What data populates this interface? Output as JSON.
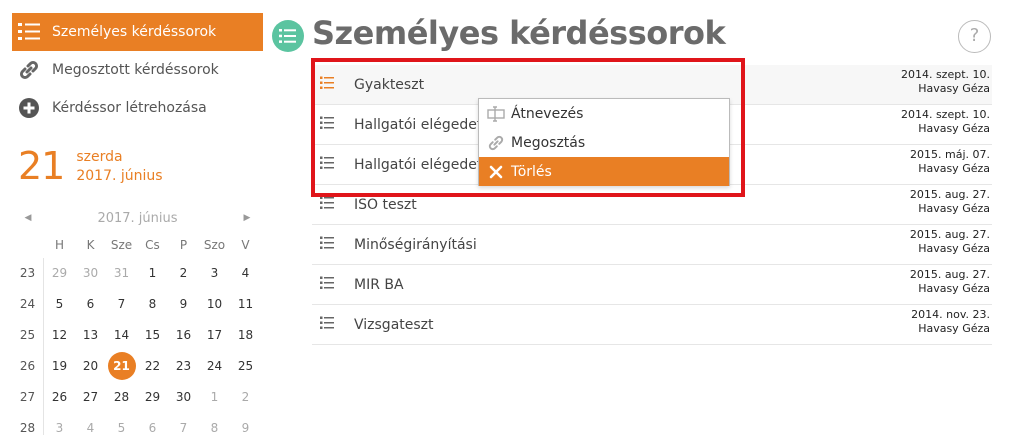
{
  "sidebar": {
    "nav": [
      {
        "label": "Személyes kérdéssorok",
        "icon": "list-icon",
        "active": true
      },
      {
        "label": "Megosztott kérdéssorok",
        "icon": "link-icon",
        "active": false
      },
      {
        "label": "Kérdéssor létrehozása",
        "icon": "plus-circle-icon",
        "active": false
      }
    ],
    "date": {
      "day": "21",
      "weekday": "szerda",
      "month_year": "2017. június"
    },
    "calendar": {
      "month_label": "2017. június",
      "weekdays": [
        "H",
        "K",
        "Sze",
        "Cs",
        "P",
        "Szo",
        "V"
      ],
      "weeks": [
        {
          "num": "23",
          "days": [
            "29",
            "30",
            "31",
            "1",
            "2",
            "3",
            "4"
          ]
        },
        {
          "num": "24",
          "days": [
            "5",
            "6",
            "7",
            "8",
            "9",
            "10",
            "11"
          ]
        },
        {
          "num": "25",
          "days": [
            "12",
            "13",
            "14",
            "15",
            "16",
            "17",
            "18"
          ]
        },
        {
          "num": "26",
          "days": [
            "19",
            "20",
            "21",
            "22",
            "23",
            "24",
            "25"
          ]
        },
        {
          "num": "27",
          "days": [
            "26",
            "27",
            "28",
            "29",
            "30",
            "1",
            "2"
          ]
        },
        {
          "num": "28",
          "days": [
            "3",
            "4",
            "5",
            "6",
            "7",
            "8",
            "9"
          ]
        }
      ],
      "today": "21"
    }
  },
  "main": {
    "title": "Személyes kérdéssorok",
    "help": "?",
    "rows": [
      {
        "name": "Gyakteszt",
        "date": "2014. szept. 10.",
        "author": "Havasy Géza"
      },
      {
        "name": "Hallgatói elégedettség",
        "date": "2014. szept. 10.",
        "author": "Havasy Géza"
      },
      {
        "name": "Hallgatói elégedettség",
        "date": "2015. máj. 07.",
        "author": "Havasy Géza"
      },
      {
        "name": "ISO teszt",
        "date": "2015. aug. 27.",
        "author": "Havasy Géza"
      },
      {
        "name": "Minőségirányítási",
        "date": "2015. aug. 27.",
        "author": "Havasy Géza"
      },
      {
        "name": "MIR BA",
        "date": "2015. aug. 27.",
        "author": "Havasy Géza"
      },
      {
        "name": "Vizsgateszt",
        "date": "2014. nov. 23.",
        "author": "Havasy Géza"
      }
    ],
    "context_menu": [
      {
        "label": "Átnevezés",
        "icon": "rename-icon",
        "active": false
      },
      {
        "label": "Megosztás",
        "icon": "link-icon",
        "active": false
      },
      {
        "label": "Törlés",
        "icon": "close-icon",
        "active": true
      }
    ]
  },
  "colors": {
    "accent": "#e97f24",
    "title_icon_bg": "#5bc4a0",
    "highlight": "#e0151a"
  }
}
